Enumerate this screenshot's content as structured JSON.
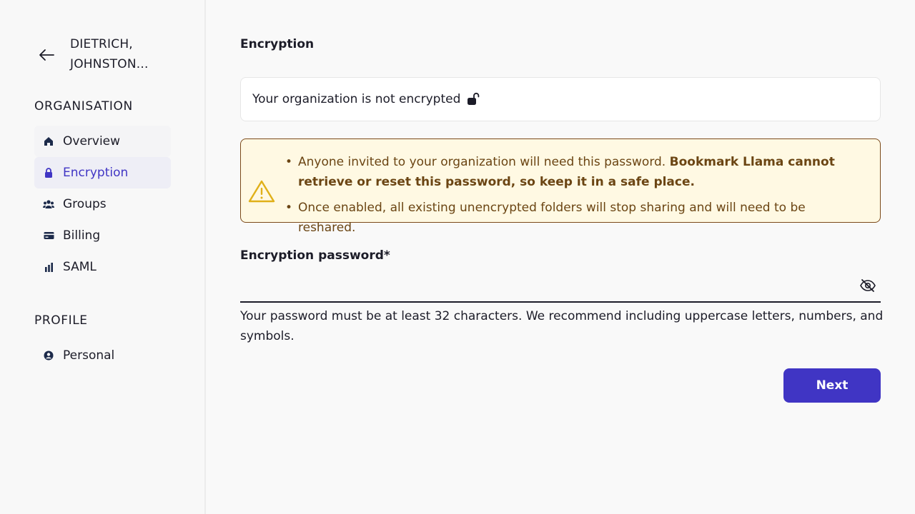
{
  "sidebar": {
    "org_name": "DIETRICH, JOHNSTON...",
    "sections": [
      {
        "title": "ORGANISATION",
        "items": [
          {
            "label": "Overview",
            "icon": "home-icon"
          },
          {
            "label": "Encryption",
            "icon": "lock-icon",
            "active": true
          },
          {
            "label": "Groups",
            "icon": "users-icon"
          },
          {
            "label": "Billing",
            "icon": "credit-card-icon"
          },
          {
            "label": "SAML",
            "icon": "bar-chart-icon"
          }
        ]
      },
      {
        "title": "PROFILE",
        "items": [
          {
            "label": "Personal",
            "icon": "user-circle-icon"
          }
        ]
      }
    ]
  },
  "main": {
    "title": "Encryption",
    "status_text": "Your organization is not encrypted",
    "warning": {
      "item1_normal": "Anyone invited to your organization will need this password. ",
      "item1_bold": "Bookmark Llama cannot retrieve or reset this password, so keep it in a safe place.",
      "item2": "Once enabled, all existing unencrypted folders will stop sharing and will need to be reshared."
    },
    "password_label": "Encryption password*",
    "password_value": "",
    "helper_text": "Your password must be at least 32 characters. We recommend including uppercase letters, numbers, and symbols.",
    "next_label": "Next"
  },
  "colors": {
    "accent": "#4035c4",
    "warning_bg": "#fff9e3",
    "warning_border": "#7b4a1a",
    "warning_text": "#6b4513",
    "warning_icon": "#e0b019"
  }
}
